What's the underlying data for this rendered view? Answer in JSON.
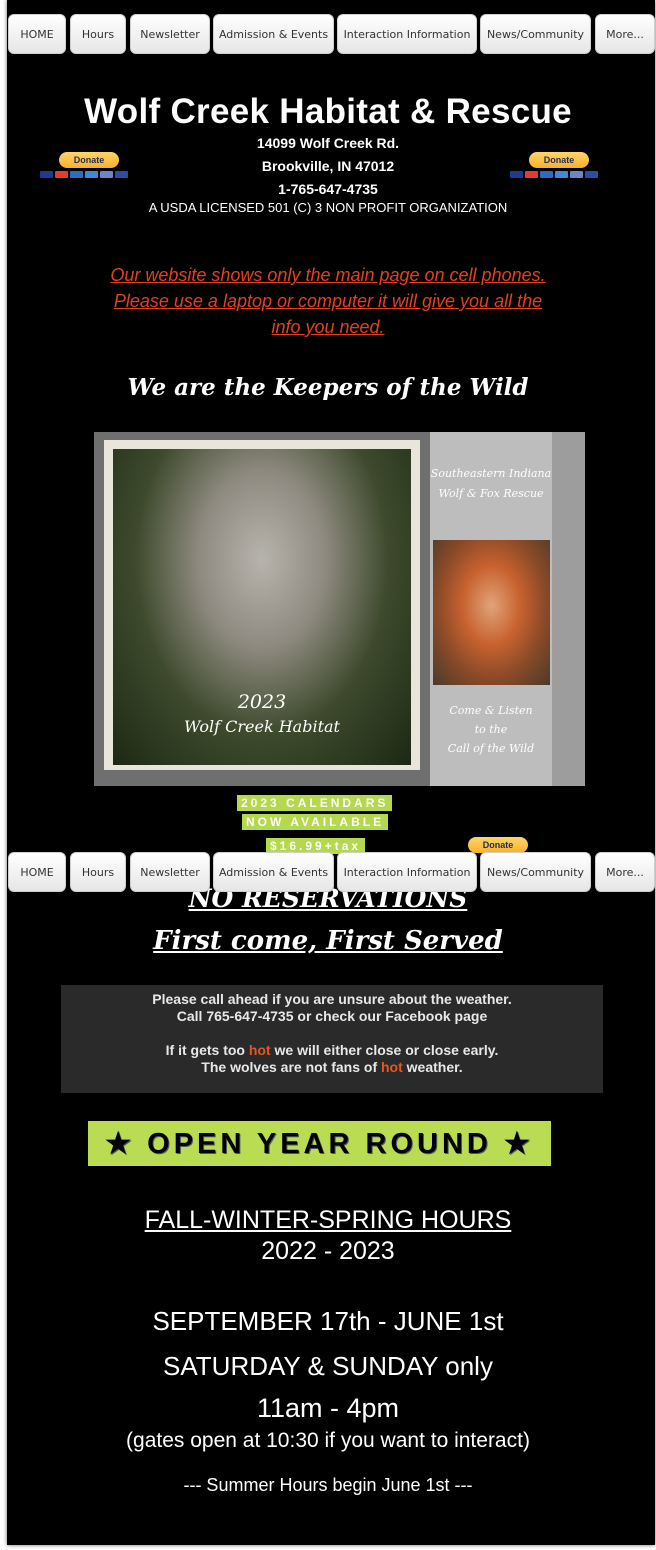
{
  "nav": {
    "items": [
      "HOME",
      "Hours",
      "Newsletter",
      "Admission & Events",
      "Interaction Information",
      "News/Community",
      "More..."
    ]
  },
  "header": {
    "title": "Wolf Creek Habitat & Rescue",
    "address_line1": "14099 Wolf Creek Rd.",
    "address_line2": "Brookville, IN 47012",
    "phone": "1-765-647-4735",
    "usda": "A USDA LICENSED  501 (C) 3 NON PROFIT  ORGANIZATION",
    "donate_label": "Donate"
  },
  "notice": {
    "line1": "Our website shows only the main page on cell phones.",
    "line2": "Please use a laptop or computer it will give you all the",
    "line3": "info you need."
  },
  "tagline": "We are the Keepers of the Wild",
  "calendar": {
    "year": "2023",
    "name": "Wolf Creek Habitat",
    "side_title1": "Southeastern Indiana",
    "side_title2": "Wolf & Fox Rescue",
    "side_caption1": "Come & Listen",
    "side_caption2": "to the",
    "side_caption3": "Call of the Wild",
    "banner1": "2023 CALENDARS",
    "banner2": "NOW AVAILABLE",
    "price": "$16.99+tax"
  },
  "reservations": {
    "line1": "NO RESERVATIONS",
    "line2": "First come, First Served"
  },
  "weather": {
    "line1": "Please call ahead if you are unsure about the weather.",
    "line2": "Call 765-647-4735 or check our Facebook page",
    "line3_pre": "If it gets too ",
    "hot": "hot",
    "line3_post": " we will either close or close early.",
    "line4_pre": "The wolves are not fans of ",
    "line4_post": " weather."
  },
  "open_banner": "★ OPEN YEAR ROUND ★",
  "hours": {
    "season": "FALL-WINTER-SPRING HOURS",
    "years": "2022 - 2023",
    "dates": "SEPTEMBER 17th - JUNE 1st",
    "days": "SATURDAY & SUNDAY only",
    "time": "11am - 4pm",
    "gates": "(gates open at 10:30 if you want to interact)",
    "summer": "--- Summer Hours begin June 1st ---"
  },
  "colors": {
    "background": "#000000",
    "accent_green": "#b9dc53",
    "warning_red": "#e2401f",
    "donate_yellow": "#f7b128"
  }
}
